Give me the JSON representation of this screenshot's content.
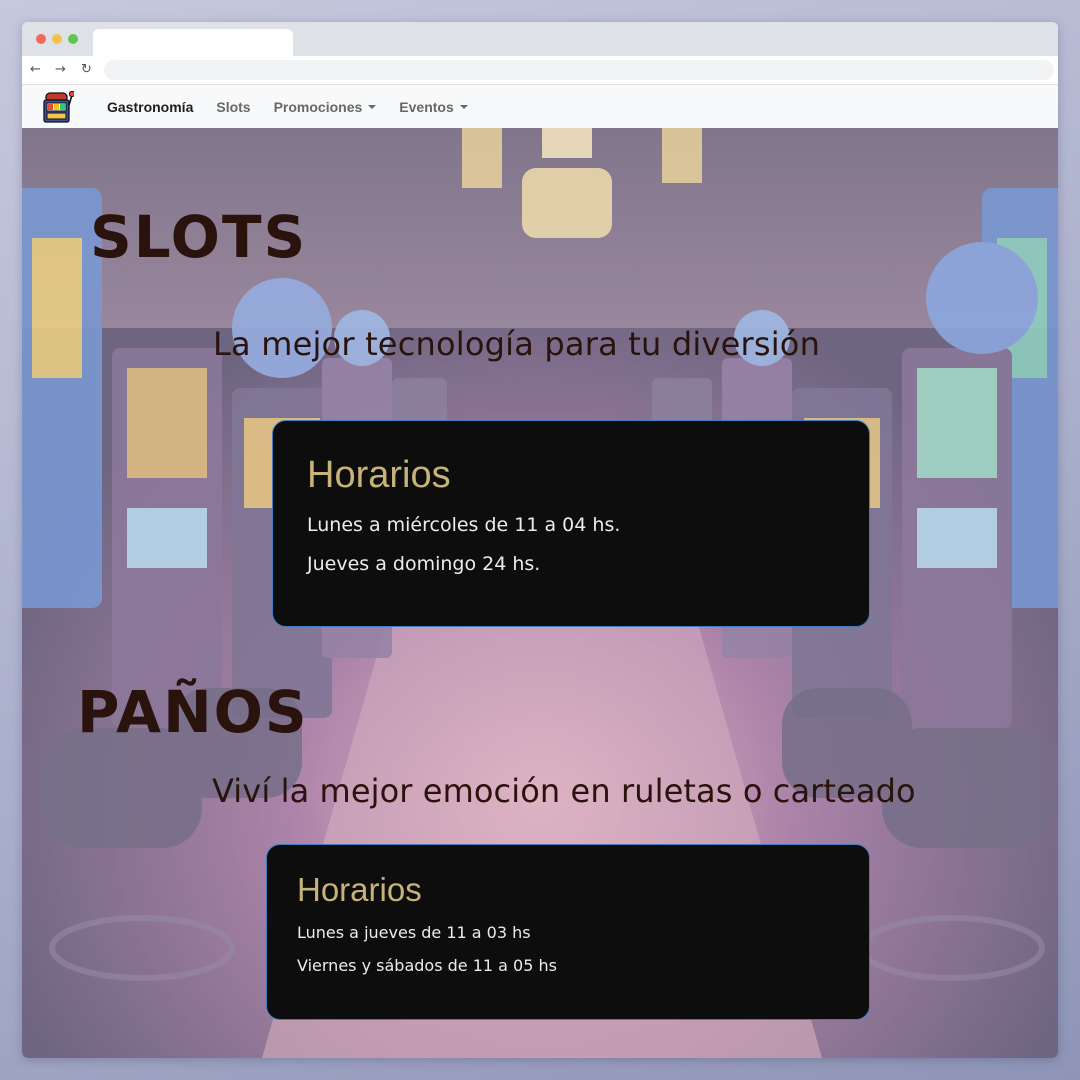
{
  "nav": {
    "brand_icon": "slot-machine-icon",
    "items": [
      {
        "label": "Gastronomía"
      },
      {
        "label": "Slots"
      },
      {
        "label": "Promociones"
      },
      {
        "label": "Eventos"
      }
    ]
  },
  "sections": [
    {
      "title": "SLOTS",
      "subtitle": "La mejor tecnología para tu diversión",
      "card": {
        "title": "Horarios",
        "lines": [
          "Lunes a miércoles de 11 a 04 hs.",
          "Jueves a domingo 24 hs."
        ]
      }
    },
    {
      "title": "PAÑOS",
      "subtitle": "Viví la mejor emoción en ruletas o carteado",
      "card": {
        "title": "Horarios",
        "lines": [
          "Lunes a jueves de 11 a 03 hs",
          "Viernes y sábados de 11 a 05 hs"
        ]
      }
    }
  ],
  "colors": {
    "heading": "#2a120d",
    "card_background": "#0d0d0d",
    "card_title": "#c7b27a",
    "card_border": "#3f7cc0"
  }
}
